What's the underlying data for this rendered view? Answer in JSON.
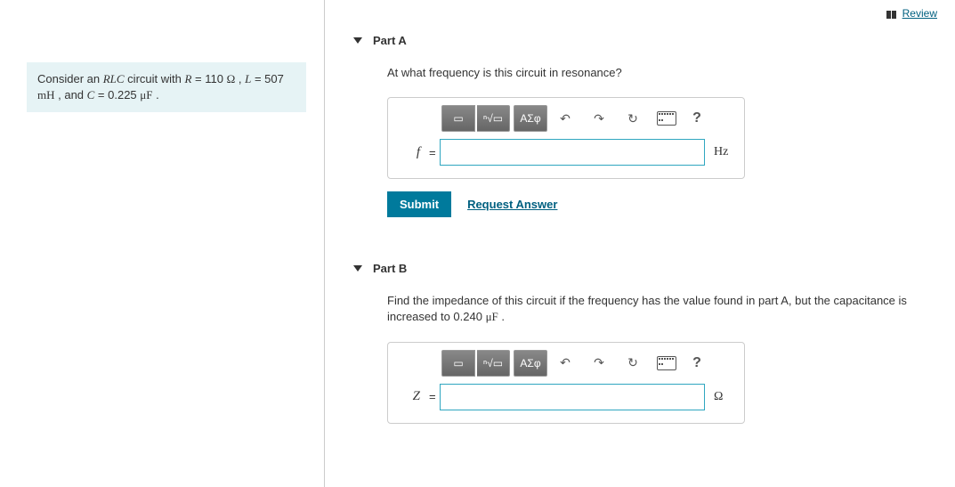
{
  "review_label": "Review",
  "problem": {
    "prefix": "Consider an ",
    "rlc": "RLC",
    "mid1": " circuit with ",
    "R_sym": "R",
    "R_eq": " = 110 ",
    "ohm": "Ω",
    "sep1": " , ",
    "L_sym": "L",
    "L_eq": " = 507 ",
    "mH": "mH",
    "sep2": " , and ",
    "C_sym": "C",
    "C_eq": " = 0.225 ",
    "muF": "μF",
    "end": " ."
  },
  "partA": {
    "title": "Part A",
    "prompt": "At what frequency is this circuit in resonance?",
    "var": "f",
    "unit": "Hz",
    "submit": "Submit",
    "request": "Request Answer"
  },
  "partB": {
    "title": "Part B",
    "prompt_pre": "Find the impedance of this circuit if the frequency has the value found in part A, but the capacitance is increased to 0.240 ",
    "prompt_unit": "μF",
    "prompt_post": " .",
    "var": "Z",
    "unit": "Ω"
  },
  "toolbar": {
    "templates": "▭",
    "root": "ⁿ√▭",
    "greek": "ΑΣφ",
    "undo": "↶",
    "redo": "↷",
    "reset": "↻",
    "keyboard": "kbd",
    "help": "?"
  }
}
